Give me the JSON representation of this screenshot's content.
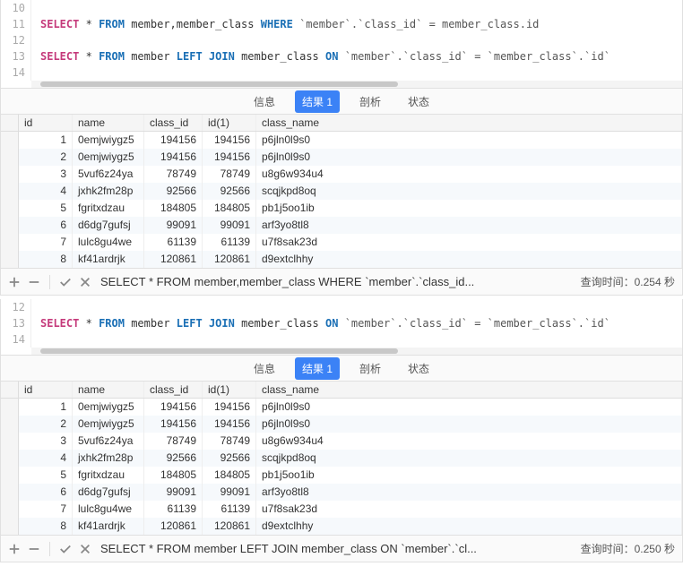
{
  "panel1": {
    "editor": {
      "lines": [
        "10",
        "11",
        "12",
        "13",
        "14"
      ],
      "line11": {
        "select": "SELECT",
        "star": "*",
        "from": "FROM",
        "tables": "member,member_class",
        "where": "WHERE",
        "cond": "`member`.`class_id` = member_class.id"
      },
      "line13": {
        "select": "SELECT",
        "star": "*",
        "from": "FROM",
        "t1": "member",
        "left": "LEFT",
        "join": "JOIN",
        "t2": "member_class",
        "on": "ON",
        "cond": "`member`.`class_id` = `member_class`.`id`"
      }
    },
    "tabs": {
      "info": "信息",
      "result": "结果 1",
      "profile": "剖析",
      "status": "状态"
    },
    "columns": {
      "id": "id",
      "name": "name",
      "class_id": "class_id",
      "id1": "id(1)",
      "class_name": "class_name"
    },
    "rows": [
      {
        "id": "1",
        "name": "0emjwiygz5",
        "class_id": "194156",
        "id1": "194156",
        "class_name": "p6jln0l9s0"
      },
      {
        "id": "2",
        "name": "0emjwiygz5",
        "class_id": "194156",
        "id1": "194156",
        "class_name": "p6jln0l9s0"
      },
      {
        "id": "3",
        "name": "5vuf6z24ya",
        "class_id": "78749",
        "id1": "78749",
        "class_name": "u8g6w934u4"
      },
      {
        "id": "4",
        "name": "jxhk2fm28p",
        "class_id": "92566",
        "id1": "92566",
        "class_name": "scqjkpd8oq"
      },
      {
        "id": "5",
        "name": "fgritxdzau",
        "class_id": "184805",
        "id1": "184805",
        "class_name": "pb1j5oo1ib"
      },
      {
        "id": "6",
        "name": "d6dg7gufsj",
        "class_id": "99091",
        "id1": "99091",
        "class_name": "arf3yo8tl8"
      },
      {
        "id": "7",
        "name": "lulc8gu4we",
        "class_id": "61139",
        "id1": "61139",
        "class_name": "u7f8sak23d"
      },
      {
        "id": "8",
        "name": "kf41ardrjk",
        "class_id": "120861",
        "id1": "120861",
        "class_name": "d9extclhhy"
      }
    ],
    "status_sql": "SELECT * FROM member,member_class WHERE `member`.`class_id...",
    "status_time": "查询时间：0.254 秒"
  },
  "panel2": {
    "editor": {
      "lines": [
        "12",
        "13",
        "14"
      ],
      "line13": {
        "select": "SELECT",
        "star": "*",
        "from": "FROM",
        "t1": "member",
        "left": "LEFT",
        "join": "JOIN",
        "t2": "member_class",
        "on": "ON",
        "cond": "`member`.`class_id` = `member_class`.`id`"
      }
    },
    "tabs": {
      "info": "信息",
      "result": "结果 1",
      "profile": "剖析",
      "status": "状态"
    },
    "columns": {
      "id": "id",
      "name": "name",
      "class_id": "class_id",
      "id1": "id(1)",
      "class_name": "class_name"
    },
    "rows": [
      {
        "id": "1",
        "name": "0emjwiygz5",
        "class_id": "194156",
        "id1": "194156",
        "class_name": "p6jln0l9s0"
      },
      {
        "id": "2",
        "name": "0emjwiygz5",
        "class_id": "194156",
        "id1": "194156",
        "class_name": "p6jln0l9s0"
      },
      {
        "id": "3",
        "name": "5vuf6z24ya",
        "class_id": "78749",
        "id1": "78749",
        "class_name": "u8g6w934u4"
      },
      {
        "id": "4",
        "name": "jxhk2fm28p",
        "class_id": "92566",
        "id1": "92566",
        "class_name": "scqjkpd8oq"
      },
      {
        "id": "5",
        "name": "fgritxdzau",
        "class_id": "184805",
        "id1": "184805",
        "class_name": "pb1j5oo1ib"
      },
      {
        "id": "6",
        "name": "d6dg7gufsj",
        "class_id": "99091",
        "id1": "99091",
        "class_name": "arf3yo8tl8"
      },
      {
        "id": "7",
        "name": "lulc8gu4we",
        "class_id": "61139",
        "id1": "61139",
        "class_name": "u7f8sak23d"
      },
      {
        "id": "8",
        "name": "kf41ardrjk",
        "class_id": "120861",
        "id1": "120861",
        "class_name": "d9extclhhy"
      }
    ],
    "status_sql": "SELECT * FROM member LEFT JOIN member_class ON `member`.`cl...",
    "status_time": "查询时间：0.250 秒"
  }
}
